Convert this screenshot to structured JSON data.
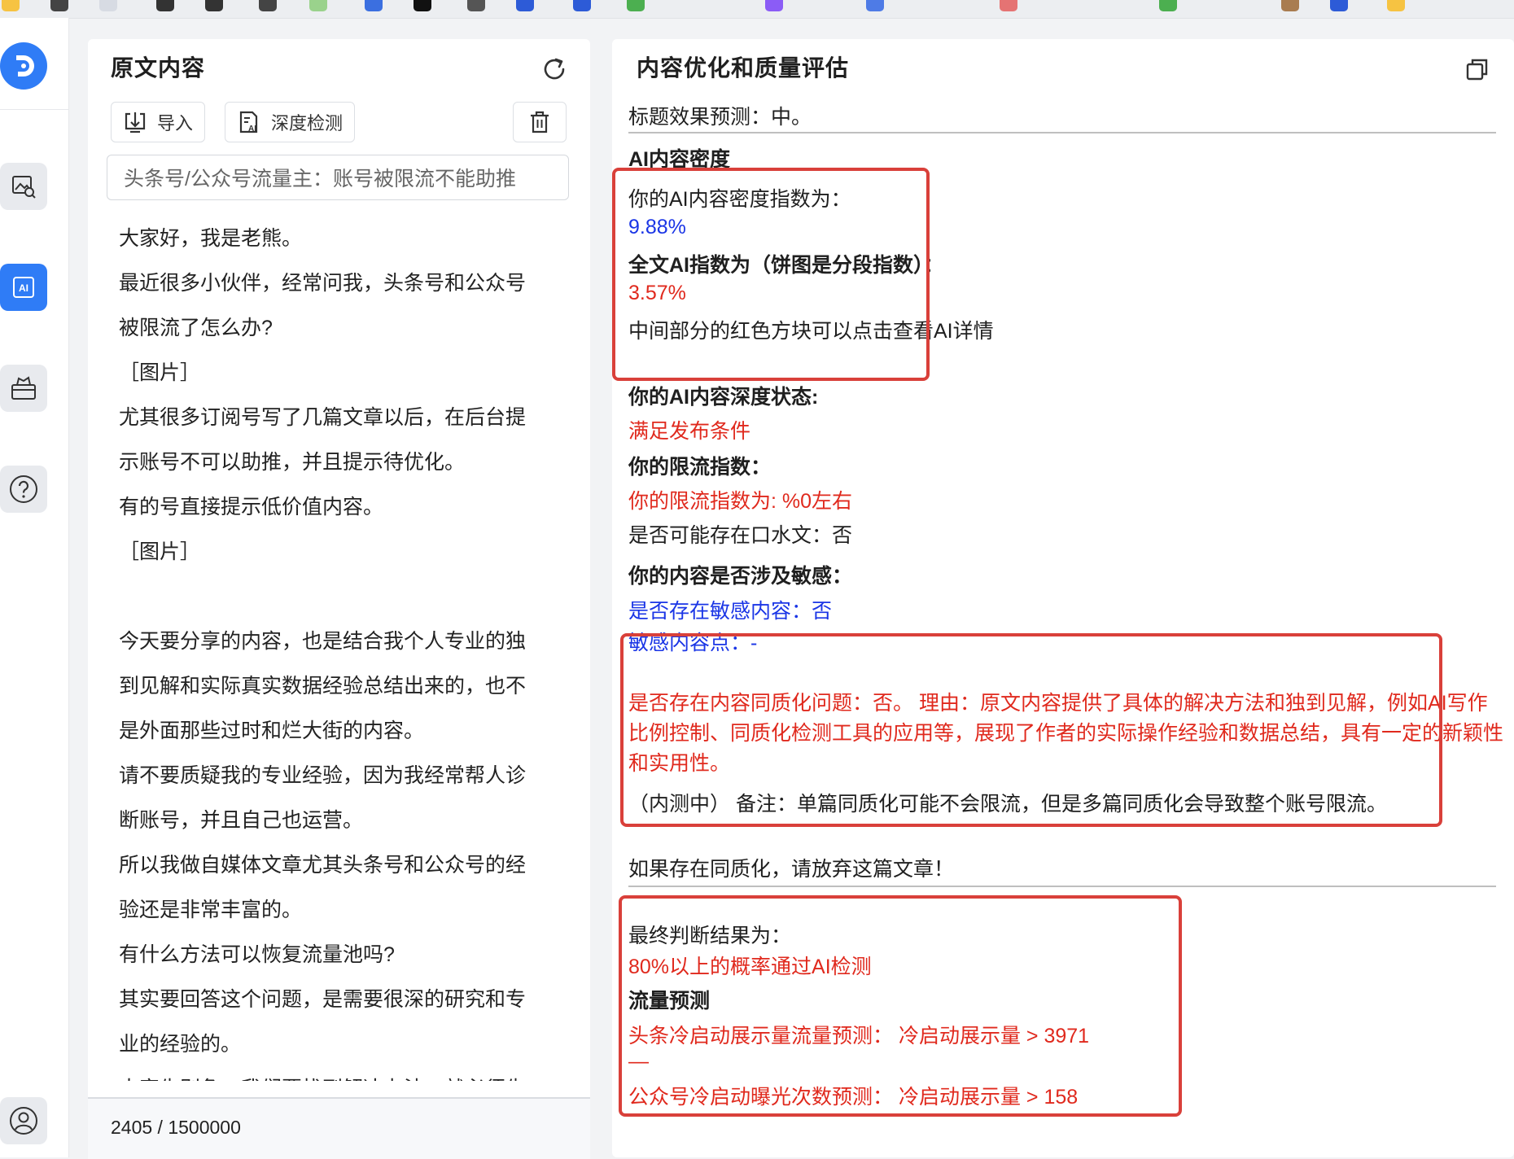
{
  "left_panel": {
    "title": "原文内容",
    "import_label": "导入",
    "deep_check_label": "深度检测",
    "title_input_value": "头条号/公众号流量主：账号被限流不能助推",
    "article_lines": [
      "大家好，我是老熊。",
      "最近很多小伙伴，经常问我，头条号和公众号",
      "被限流了怎么办?",
      "［图片］",
      "尤其很多订阅号写了几篇文章以后，在后台提",
      "示账号不可以助推，并且提示待优化。",
      "有的号直接提示低价值内容。",
      "［图片］",
      "",
      "今天要分享的内容，也是结合我个人专业的独",
      "到见解和实际真实数据经验总结出来的，也不",
      "是外面那些过时和烂大街的内容。",
      "请不要质疑我的专业经验，因为我经常帮人诊",
      "断账号，并且自己也运营。",
      "所以我做自媒体文章尤其头条号和公众号的经",
      "验还是非常丰富的。",
      "有什么方法可以恢复流量池吗?",
      "其实要回答这个问题，是需要很深的研究和专",
      "业的经验的。",
      "大家先别急，我们要找到解决办法，就必须先"
    ],
    "char_count": "2405 / 1500000"
  },
  "right_panel": {
    "title": "内容优化和质量评估",
    "title_effect": "标题效果预测：中。",
    "ai_density_heading": "AI内容密度",
    "ai_density_label": "你的AI内容密度指数为：",
    "ai_density_value": "9.88%",
    "full_ai_label": "全文AI指数为（饼图是分段指数）：",
    "full_ai_value": "3.57%",
    "click_hint": "中间部分的红色方块可以点击查看AI详情",
    "depth_status_label": "你的AI内容深度状态:",
    "depth_status_value": "满足发布条件",
    "limit_label": "你的限流指数：",
    "limit_value": "你的限流指数为: %0左右",
    "water_text": "是否可能存在口水文：否",
    "sensitive_label": "你的内容是否涉及敏感：",
    "sensitive_value": "是否存在敏感内容：否",
    "sensitive_points": "敏感内容点：-",
    "homogeneity_text": "是否存在内容同质化问题：否。 理由：原文内容提供了具体的解决方法和独到见解，例如AI写作比例控制、同质化检测工具的应用等，展现了作者的实际操作经验和数据总结，具有一定的新颖性和实用性。",
    "beta_note": "（内测中） 备注：单篇同质化可能不会限流，但是多篇同质化会导致整个账号限流。",
    "abandon_note": "如果存在同质化，请放弃这篇文章！",
    "final_label": "最终判断结果为：",
    "final_value": "80%以上的概率通过AI检测",
    "traffic_heading": "流量预测",
    "toutiao_forecast": "头条冷启动展示量流量预测： 冷启动展示量 > 3971",
    "separator": "—",
    "wechat_forecast": "公众号冷启动曝光次数预测： 冷启动展示量 > 158"
  },
  "colors": {
    "accent": "#2f7cf6",
    "highlight_red": "#e0291d",
    "info_blue": "#1a35e6",
    "outline_red": "#d9403a"
  },
  "icons": {
    "logo": "app-logo-icon",
    "rail": [
      "image-search-icon",
      "ai-icon",
      "toolbox-icon",
      "help-icon",
      "user-icon"
    ],
    "refresh": "refresh-icon",
    "copy": "copy-icon",
    "import": "import-icon",
    "deep_check": "ai-document-icon",
    "delete": "trash-icon"
  }
}
